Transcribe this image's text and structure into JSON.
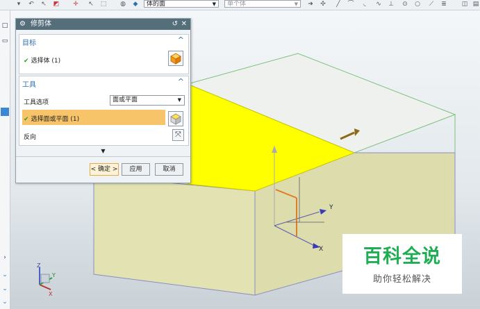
{
  "toolbar": {
    "face_filter": "体的面",
    "body_filter": "单个体"
  },
  "dialog": {
    "title": "修剪体",
    "target_section": {
      "heading": "目标",
      "select_body_label": "选择体 (1)"
    },
    "tool_section": {
      "heading": "工具",
      "tool_option_label": "工具选项",
      "tool_option_value": "面或平面",
      "select_face_label": "选择面或平面 (1)",
      "reverse_label": "反向"
    },
    "buttons": {
      "ok": "< 确定 >",
      "apply": "应用",
      "cancel": "取消"
    }
  },
  "viewport": {
    "axis_y_label": "Y",
    "axis_x_label": "X",
    "triad_z": "Z",
    "triad_x": "X",
    "triad_y": "Y"
  },
  "watermark": {
    "title": "百科全说",
    "subtitle": "助你轻松解决"
  },
  "colors": {
    "dialog_title_bar": "#546e7a",
    "section_heading": "#2e6fb4",
    "selection_highlight": "#f7c46a",
    "trim_face": "#ffff00",
    "body_fill": "#e4e4b4",
    "watermark_green": "#1fae53"
  }
}
